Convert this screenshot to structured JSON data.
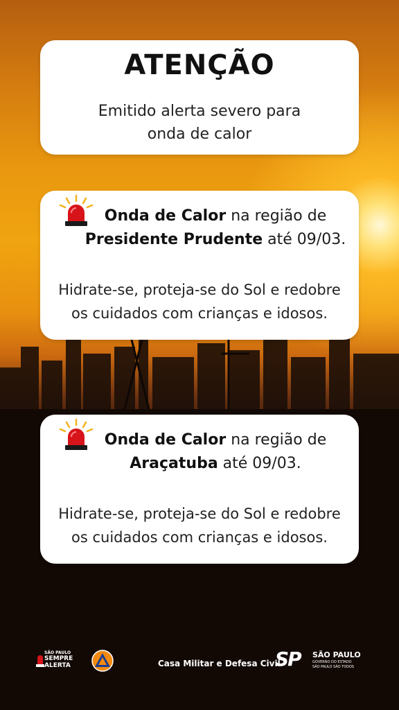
{
  "header": {
    "title": "ATENÇÃO",
    "subtitle_line1": "Emitido alerta severo para",
    "subtitle_line2": "onda de calor"
  },
  "alerts": [
    {
      "icon": "siren-icon",
      "phenomenon": "Onda de Calor",
      "region_prefix": " na região de",
      "region": "Presidente Prudente",
      "until": " até 09/03.",
      "advice_line1": "Hidrate-se, proteja-se do Sol e redobre",
      "advice_line2": "os cuidados com crianças e idosos."
    },
    {
      "icon": "siren-icon",
      "phenomenon": "Onda de Calor",
      "region_prefix": " na região de",
      "region": "Araçatuba",
      "until": " até 09/03.",
      "advice_line1": "Hidrate-se, proteja-se do Sol e redobre",
      "advice_line2": "os cuidados com crianças e idosos."
    }
  ],
  "footer": {
    "sp_alert_logo_line1": "SÃO PAULO",
    "sp_alert_logo_line2": "SEMPRE",
    "sp_alert_logo_line3": "ALERTA",
    "agency": "Casa Militar e Defesa Civil",
    "gov_logo_mark": "SP",
    "gov_name": "SÃO PAULO",
    "gov_sub1": "GOVERNO DO ESTADO",
    "gov_sub2": "SÃO PAULO SÃO TODOS"
  },
  "colors": {
    "siren_red": "#d7141a",
    "sky_orange": "#f0a410",
    "card_bg": "#ffffff"
  }
}
